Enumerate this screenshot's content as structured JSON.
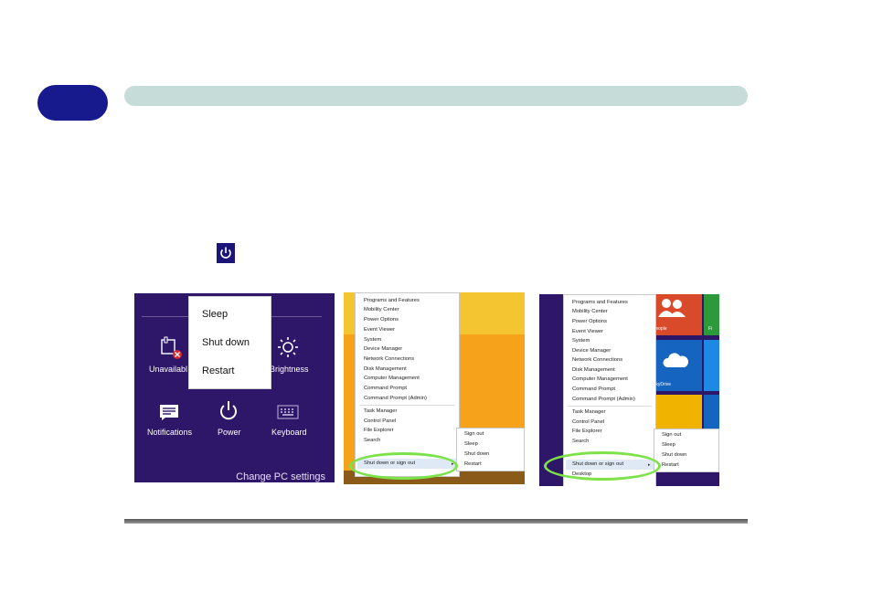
{
  "header": {
    "chapter_tab": "",
    "bar_title": ""
  },
  "charms_panel": {
    "flyout_items": [
      "Sleep",
      "Shut down",
      "Restart"
    ],
    "tiles": [
      {
        "label": "Unavailabl",
        "icon": "network-unavailable-icon"
      },
      {
        "label": "Brightness",
        "icon": "brightness-icon"
      },
      {
        "label": "Notifications",
        "icon": "notifications-icon"
      },
      {
        "label": "Power",
        "icon": "power-icon"
      },
      {
        "label": "Keyboard",
        "icon": "keyboard-icon"
      }
    ],
    "change_settings": "Change PC settings"
  },
  "context_menu_desktop": {
    "items": [
      "Programs and Features",
      "Mobility Center",
      "Power Options",
      "Event Viewer",
      "System",
      "Device Manager",
      "Network Connections",
      "Disk Management",
      "Computer Management",
      "Command Prompt",
      "Command Prompt (Admin)"
    ],
    "items2": [
      "Task Manager",
      "Control Panel",
      "File Explorer",
      "Search"
    ],
    "highlighted": "Shut down or sign out",
    "submenu": [
      "Sign out",
      "Sleep",
      "Shut down",
      "Restart"
    ]
  },
  "context_menu_start": {
    "items": [
      "Programs and Features",
      "Mobility Center",
      "Power Options",
      "Event Viewer",
      "System",
      "Device Manager",
      "Network Connections",
      "Disk Management",
      "Computer Management",
      "Command Prompt",
      "Command Prompt (Admin)"
    ],
    "items2": [
      "Task Manager",
      "Control Panel",
      "File Explorer",
      "Search"
    ],
    "highlighted": "Shut down or sign out",
    "below": "Desktop",
    "submenu": [
      "Sign out",
      "Sleep",
      "Shut down",
      "Restart"
    ],
    "tile_labels": [
      "People",
      "SkyDrive",
      "Fi"
    ]
  },
  "colors": {
    "accent": "#171a8c",
    "header_bar": "#c5dcd9",
    "charms_bg": "#2e1668",
    "ring": "#7de24a"
  }
}
